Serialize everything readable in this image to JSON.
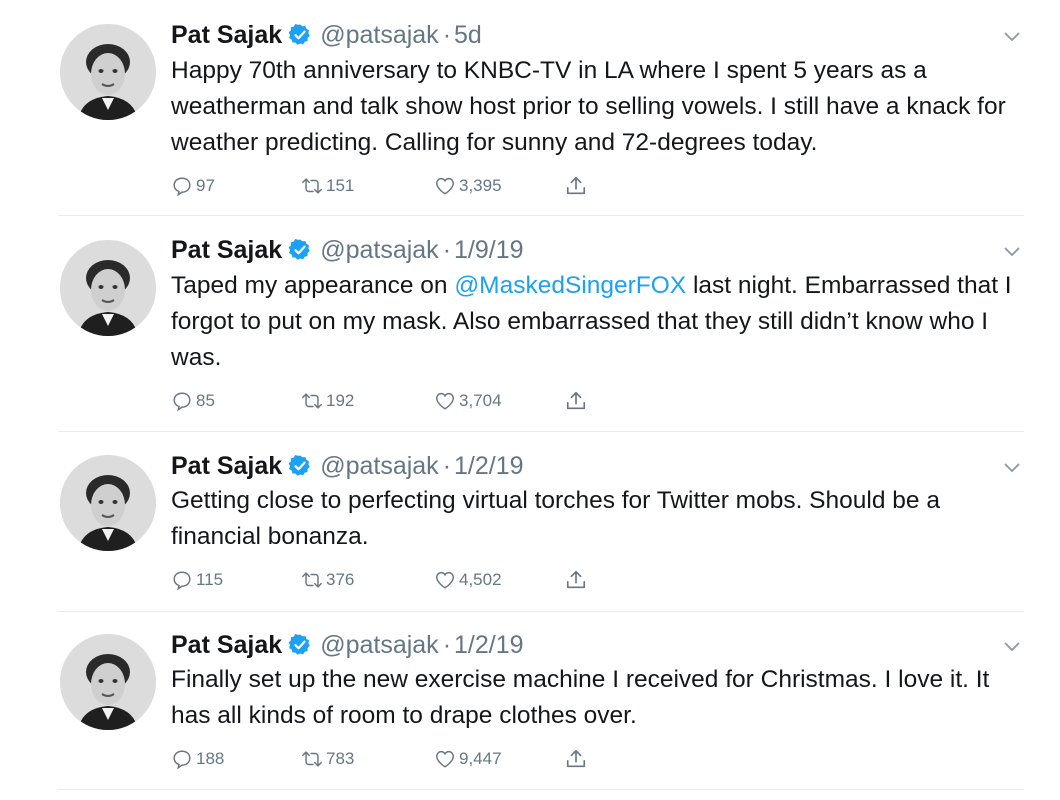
{
  "colors": {
    "text": "#14171a",
    "secondary": "#657786",
    "link": "#1da1f2",
    "verified": "#1da1f2",
    "divider": "#e6ecf0"
  },
  "tweets": [
    {
      "name": "Pat Sajak",
      "handle": "@patsajak",
      "separator": "·",
      "time": "5d",
      "text_before": "Happy 70th anniversary to KNBC-TV in LA where I spent 5 years as a weatherman and talk show host prior to selling vowels. I still have a knack for weather predicting. Calling for sunny and 72-degrees today.",
      "mention": "",
      "text_after": "",
      "replies": "97",
      "retweets": "151",
      "likes": "3,395"
    },
    {
      "name": "Pat Sajak",
      "handle": "@patsajak",
      "separator": "·",
      "time": "1/9/19",
      "text_before": "Taped my appearance on ",
      "mention": "@MaskedSingerFOX",
      "text_after": " last night. Embarrassed that I forgot to put on my mask. Also embarrassed that they still didn’t know who I was.",
      "replies": "85",
      "retweets": "192",
      "likes": "3,704"
    },
    {
      "name": "Pat Sajak",
      "handle": "@patsajak",
      "separator": "·",
      "time": "1/2/19",
      "text_before": "Getting close to perfecting virtual torches for Twitter mobs. Should be a financial bonanza.",
      "mention": "",
      "text_after": "",
      "replies": "115",
      "retweets": "376",
      "likes": "4,502"
    },
    {
      "name": "Pat Sajak",
      "handle": "@patsajak",
      "separator": "·",
      "time": "1/2/19",
      "text_before": "Finally set up the new exercise machine I received for Christmas. I love it. It has all kinds of room to drape clothes over.",
      "mention": "",
      "text_after": "",
      "replies": "188",
      "retweets": "783",
      "likes": "9,447"
    }
  ],
  "icons": {
    "verified": "verified-badge-icon",
    "caret": "chevron-down-icon",
    "reply": "reply-icon",
    "retweet": "retweet-icon",
    "like": "heart-icon",
    "share": "share-icon"
  }
}
